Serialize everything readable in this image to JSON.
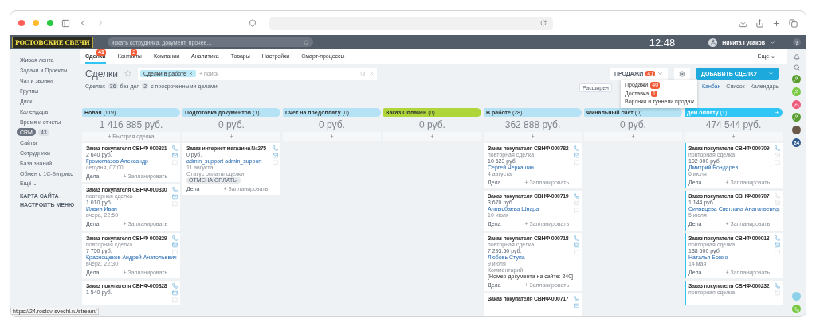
{
  "browser": {
    "status_url": "https://24.rostov-svechi.ru/stream/"
  },
  "topbar": {
    "logo": "РОСТОВСКИЕ СВЕЧИ",
    "search_placeholder": "искать сотрудника, документ, прочее...",
    "time": "12:48",
    "user": "Никита Гусаков",
    "help": "?"
  },
  "sidebar": {
    "items": [
      {
        "label": "Живая лента",
        "selected": false
      },
      {
        "label": "Задачи и Проекты",
        "selected": false
      },
      {
        "label": "Чат и звонки",
        "selected": false
      },
      {
        "label": "Группы",
        "selected": false
      },
      {
        "label": "Диск",
        "selected": false
      },
      {
        "label": "Календарь",
        "selected": false
      },
      {
        "label": "Время и отчеты",
        "selected": false
      },
      {
        "label": "CRM",
        "selected": true,
        "counter": "43"
      },
      {
        "label": "Сайты",
        "selected": false
      },
      {
        "label": "Сотрудники",
        "selected": false
      },
      {
        "label": "База знаний",
        "selected": false
      },
      {
        "label": "Обмен с 1С-Битрикс",
        "selected": false
      },
      {
        "label": "Ещё ⌄",
        "selected": false
      }
    ],
    "links": [
      "КАРТА САЙТА",
      "НАСТРОИТЬ МЕНЮ"
    ]
  },
  "tabs": [
    {
      "label": "Сделки",
      "selected": true,
      "badge": "41"
    },
    {
      "label": "Контакты",
      "selected": false,
      "badge": "2"
    },
    {
      "label": "Компании",
      "selected": false
    },
    {
      "label": "Аналитика",
      "selected": false
    },
    {
      "label": "Товары",
      "selected": false
    },
    {
      "label": "Настройки",
      "selected": false
    },
    {
      "label": "Смарт-процессы",
      "selected": false
    }
  ],
  "more_tab": "Еще ⌄",
  "title": "Сделки",
  "filter": {
    "chip": "Сделки в работе",
    "placeholder": "+ поиск"
  },
  "pipeline_button": {
    "label": "ПРОДАЖИ",
    "badge": "41"
  },
  "add_button": "ДОБАВИТЬ СДЕЛКУ",
  "counters": [
    {
      "label": "Сделки:"
    },
    {
      "count": "36",
      "label": "без дел"
    },
    {
      "count": "2",
      "label": "с просроченными делами"
    }
  ],
  "extended_button": "Расширен",
  "views": [
    {
      "label": "Канбан",
      "selected": true
    },
    {
      "label": "Список",
      "selected": false
    },
    {
      "label": "Календарь",
      "selected": false
    }
  ],
  "pipeline_menu": [
    {
      "label": "Продажи",
      "badge": "40"
    },
    {
      "label": "Доставка",
      "badge": "1"
    },
    {
      "label": "Воронки и туннели продаж"
    }
  ],
  "columns": [
    {
      "name": "Новая",
      "count": "(119)",
      "color": "#b5e3f5",
      "highlighted": false,
      "sum": "1 416 885 руб.",
      "add": "+ Быстрая сделка",
      "cards": [
        {
          "title": "Заказ покупателя СВНФ-000831",
          "amount": "2 640 руб.",
          "contact": "Громоглазов Александр",
          "date": "сегодня, 07:00",
          "phone": true,
          "email": true,
          "activities": "Дела",
          "plan": "+ Запланировать"
        },
        {
          "title": "Заказ покупателя СВНФ-000830",
          "type": "повторная сделка",
          "amount": "1 010 руб.",
          "contact": "Ильин Иван",
          "date": "вчера, 22:50",
          "phone": true,
          "email": true,
          "activities": "Дела",
          "plan": "+ Запланировать"
        },
        {
          "title": "Заказ покупателя СВНФ-000829",
          "type": "повторная сделка",
          "amount": "7 750 руб.",
          "contact": "Краснощеков Андрей Анатольевич",
          "date": "вчера, 22:30",
          "phone": true,
          "email": true,
          "activities": "Дела",
          "plan": "+ Запланировать"
        },
        {
          "title": "Заказ покупателя СВНФ-000828",
          "amount": "1 540 руб.",
          "phone": true,
          "email": true
        }
      ]
    },
    {
      "name": "Подготовка документов",
      "count": "(1)",
      "color": "#b5e3f5",
      "highlighted": false,
      "sum": "0 руб.",
      "add": "+",
      "cards": [
        {
          "title": "Заказ интернет-магазина №275",
          "amount": "0 руб.",
          "contact": "admin_support admin_support",
          "date": "11 августа",
          "status_label": "Статус оплаты сделки",
          "status": "ОТМЕНА ОПЛАТЫ",
          "phone": true,
          "email": true,
          "activities": "Дела",
          "plan": "+ Запланировать"
        }
      ]
    },
    {
      "name": "Счёт на предоплату",
      "count": "(0)",
      "color": "#b5e3f5",
      "highlighted": false,
      "sum": "0 руб.",
      "add": "+"
    },
    {
      "name": "Заказ Оплачен",
      "count": "(0)",
      "color": "#aed53a",
      "highlighted": false,
      "sum": "0 руб.",
      "add": "+"
    },
    {
      "name": "В работе",
      "count": "(28)",
      "color": "#b5e3f5",
      "highlighted": false,
      "sum": "362 888 руб.",
      "add": "+",
      "cards": [
        {
          "title": "Заказ покупателя СВНФ-000782",
          "type": "повторная сделка",
          "amount": "10 623 руб.",
          "contact": "Сергей Черкашин",
          "date": "4 августа",
          "phone": true,
          "email": true,
          "activities": "Дела",
          "plan": "+ Запланировать"
        },
        {
          "title": "Заказ покупателя СВНФ-000719",
          "amount": "3 670 руб.",
          "contact": "Алпысбаева Шнара",
          "date": "10 июля",
          "phone": true,
          "email": false,
          "activities": "Дела",
          "plan": "+ Запланировать"
        },
        {
          "title": "Заказ покупателя СВНФ-000718",
          "type": "повторная сделка",
          "amount": "7 293.50 руб.",
          "contact": "Любовь Ступа",
          "date": "9 июля",
          "comment_label": "Комментарий",
          "comment": "[Номер документа на сайте: 240]",
          "phone": true,
          "email": true,
          "activities": "Дела",
          "plan": "+ Запланировать"
        },
        {
          "title": "Заказ покупателя СВНФ-000717",
          "phone": true,
          "email": true
        }
      ]
    },
    {
      "name": "Финальный счёт",
      "count": "(0)",
      "color": "#b5e3f5",
      "highlighted": false,
      "sum": "0 руб.",
      "add": "+"
    },
    {
      "name": "дем оплату",
      "count": "(1)",
      "color": "#2fc6f6",
      "highlighted": true,
      "sum": "474 544 руб.",
      "add": "+",
      "cards": [
        {
          "title": "Заказ покупателя СВНФ-000709",
          "type": "повторная сделка",
          "amount": "102 000 руб.",
          "contact": "Дмитрий Бондарев",
          "date": "6 июля",
          "phone": true,
          "email": false,
          "activities": "Дела",
          "plan": "+ Запланировать"
        },
        {
          "title": "Заказ покупателя СВНФ-000707",
          "amount": "1 144 руб.",
          "contact": "Синявцева Светлана Анатольевна",
          "date": "5 июля",
          "phone": false,
          "email": false,
          "activities": "Дела",
          "plan": "+ Запланировать"
        },
        {
          "title": "Заказ покупателя СВНФ-000013",
          "type": "повторная сделка",
          "amount": "138 600 руб.",
          "contact": "Наталья Божко",
          "date": "14 мая",
          "phone": true,
          "email": true,
          "activities": "Дела",
          "plan": "+ Запланировать"
        },
        {
          "title": "Заказ покупателя СВНФ-000232",
          "type": "повторная сделка",
          "phone": true,
          "email": false
        }
      ]
    }
  ],
  "right_rail": {
    "counter": "24"
  }
}
